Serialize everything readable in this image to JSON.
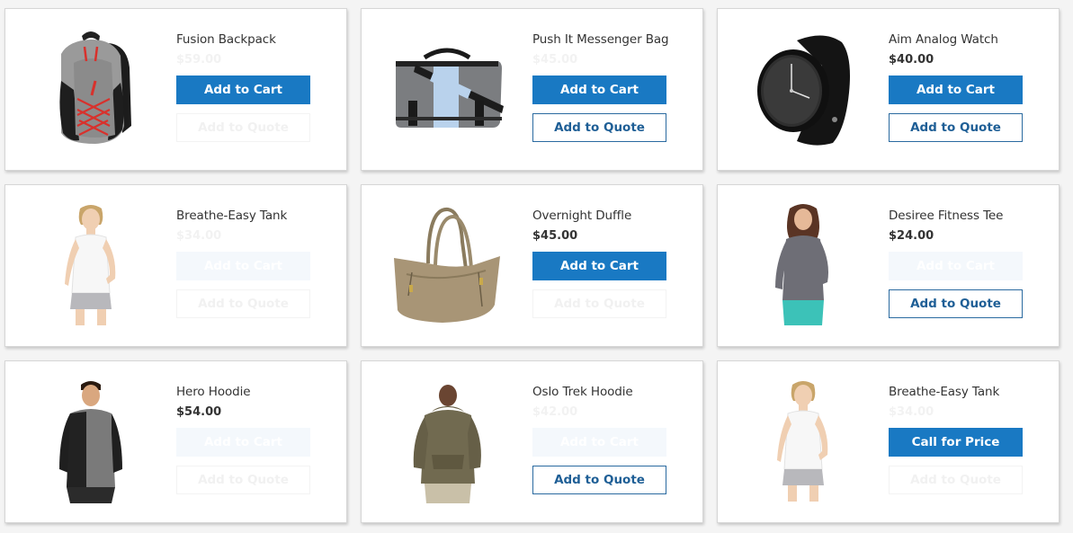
{
  "colors": {
    "primary_button": "#1979c3",
    "secondary_button_border": "#2a6aa0",
    "secondary_button_text": "#1f5f96",
    "text": "#333333",
    "page_background": "#f4f4f4"
  },
  "products": [
    {
      "name": "Fusion Backpack",
      "price": "$59.00",
      "price_visible": false,
      "image_icon": "backpack-image",
      "primary_button": {
        "label": "Add to Cart",
        "enabled": true
      },
      "secondary_button": {
        "label": "Add to Quote",
        "enabled": false
      }
    },
    {
      "name": "Push It Messenger Bag",
      "price": "$45.00",
      "price_visible": false,
      "image_icon": "messenger-bag-image",
      "primary_button": {
        "label": "Add to Cart",
        "enabled": true
      },
      "secondary_button": {
        "label": "Add to Quote",
        "enabled": true
      }
    },
    {
      "name": "Aim Analog Watch",
      "price": "$40.00",
      "price_visible": true,
      "image_icon": "watch-image",
      "primary_button": {
        "label": "Add to Cart",
        "enabled": true
      },
      "secondary_button": {
        "label": "Add to Quote",
        "enabled": true
      }
    },
    {
      "name": "Breathe-Easy Tank",
      "price": "$34.00",
      "price_visible": false,
      "image_icon": "tank-top-model-image",
      "primary_button": {
        "label": "Add to Cart",
        "enabled": false
      },
      "secondary_button": {
        "label": "Add to Quote",
        "enabled": false
      }
    },
    {
      "name": "Overnight Duffle",
      "price": "$45.00",
      "price_visible": true,
      "image_icon": "duffle-bag-image",
      "primary_button": {
        "label": "Add to Cart",
        "enabled": true
      },
      "secondary_button": {
        "label": "Add to Quote",
        "enabled": false
      }
    },
    {
      "name": "Desiree Fitness Tee",
      "price": "$24.00",
      "price_visible": true,
      "image_icon": "fitness-tee-model-image",
      "primary_button": {
        "label": "Add to Cart",
        "enabled": false
      },
      "secondary_button": {
        "label": "Add to Quote",
        "enabled": true
      }
    },
    {
      "name": "Hero Hoodie",
      "price": "$54.00",
      "price_visible": true,
      "image_icon": "hoodie-model-image",
      "primary_button": {
        "label": "Add to Cart",
        "enabled": false
      },
      "secondary_button": {
        "label": "Add to Quote",
        "enabled": false
      }
    },
    {
      "name": "Oslo Trek Hoodie",
      "price": "$42.00",
      "price_visible": false,
      "image_icon": "trek-hoodie-model-image",
      "primary_button": {
        "label": "Add to Cart",
        "enabled": false
      },
      "secondary_button": {
        "label": "Add to Quote",
        "enabled": true
      }
    },
    {
      "name": "Breathe-Easy Tank",
      "price": "$34.00",
      "price_visible": false,
      "image_icon": "tank-top-model-image",
      "primary_button": {
        "label": "Call for Price",
        "enabled": true
      },
      "secondary_button": {
        "label": "Add to Quote",
        "enabled": false
      }
    }
  ]
}
